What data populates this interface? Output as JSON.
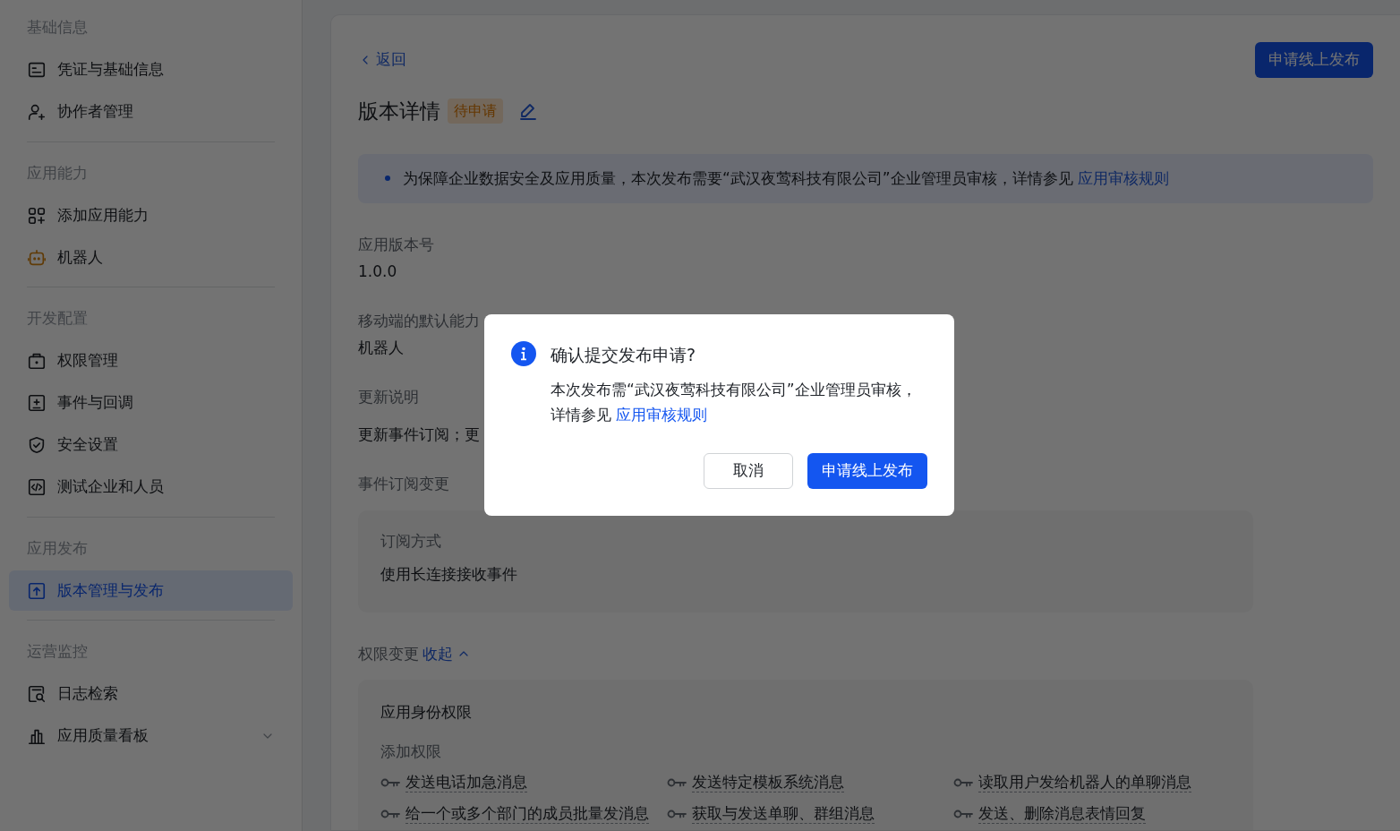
{
  "sidebar": {
    "groups": [
      {
        "title": "基础信息",
        "items": [
          {
            "label": "凭证与基础信息",
            "selected": false,
            "kind": "link"
          },
          {
            "label": "协作者管理",
            "selected": false,
            "kind": "link"
          }
        ]
      },
      {
        "title": "应用能力",
        "items": [
          {
            "label": "添加应用能力",
            "selected": false,
            "kind": "link"
          },
          {
            "label": "机器人",
            "selected": false,
            "kind": "link"
          }
        ]
      },
      {
        "title": "开发配置",
        "items": [
          {
            "label": "权限管理",
            "selected": false,
            "kind": "link"
          },
          {
            "label": "事件与回调",
            "selected": false,
            "kind": "link"
          },
          {
            "label": "安全设置",
            "selected": false,
            "kind": "link"
          },
          {
            "label": "测试企业和人员",
            "selected": false,
            "kind": "link"
          }
        ]
      },
      {
        "title": "应用发布",
        "items": [
          {
            "label": "版本管理与发布",
            "selected": true,
            "kind": "link"
          }
        ]
      },
      {
        "title": "运营监控",
        "items": [
          {
            "label": "日志检索",
            "selected": false,
            "kind": "link"
          },
          {
            "label": "应用质量看板",
            "selected": false,
            "kind": "collapsible"
          }
        ]
      }
    ]
  },
  "header": {
    "back": "返回",
    "publish_button": "申请线上发布",
    "title": "版本详情",
    "status_tag": "待申请"
  },
  "notice": {
    "text": "为保障企业数据安全及应用质量，本次发布需要“武汉夜莺科技有限公司”企业管理员审核，详情参见",
    "link": "应用审核规则"
  },
  "fields": [
    {
      "label": "应用版本号",
      "value": "1.0.0"
    },
    {
      "label": "移动端的默认能力",
      "value": "机器人"
    },
    {
      "label": "更新说明",
      "value": "更新事件订阅；更"
    }
  ],
  "event_changes": {
    "title": "事件订阅变更",
    "label": "订阅方式",
    "value": "使用长连接接收事件"
  },
  "permission_changes": {
    "title": "权限变更",
    "toggle": "收起",
    "expanded": true,
    "group_title": "应用身份权限",
    "subtitle": "添加权限",
    "items": [
      "发送电话加急消息",
      "发送特定模板系统消息",
      "读取用户发给机器人的单聊消息",
      "给一个或多个部门的成员批量发消息",
      "获取与发送单聊、群组消息",
      "发送、删除消息表情回复"
    ]
  },
  "dialog": {
    "title": "确认提交发布申请?",
    "text": "本次发布需“武汉夜莺科技有限公司”企业管理员审核，详情参见",
    "link": "应用审核规则",
    "cancel": "取消",
    "confirm": "申请线上发布"
  }
}
